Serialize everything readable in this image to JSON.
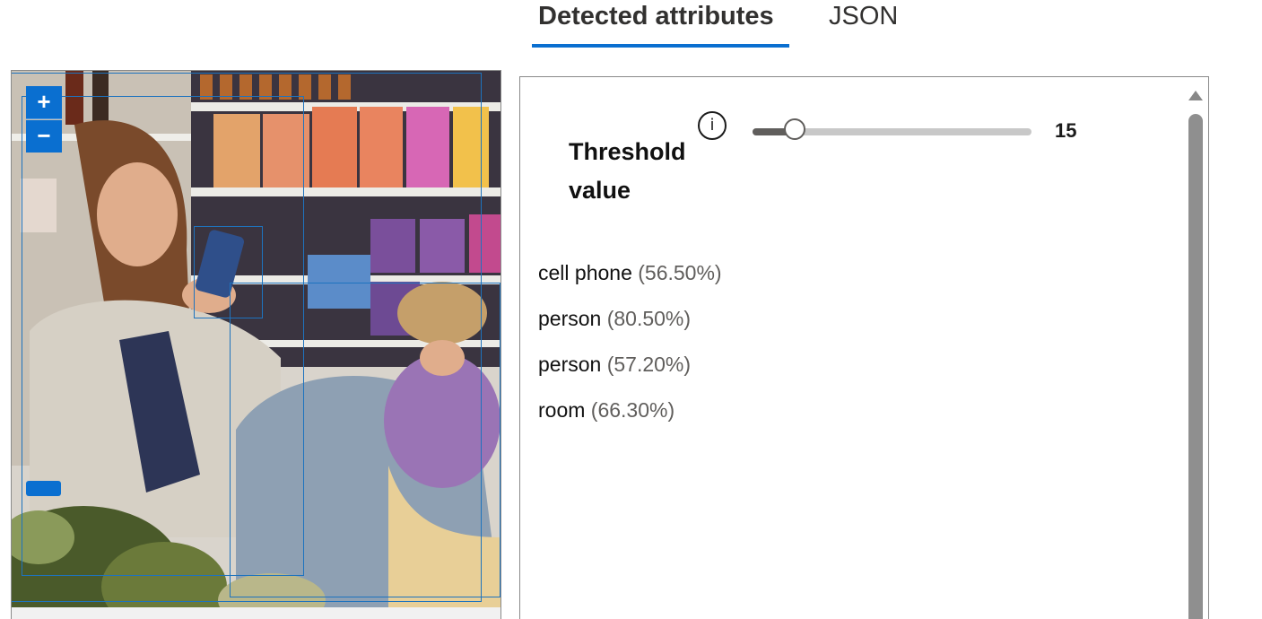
{
  "tabs": [
    {
      "label": "Detected attributes",
      "selected": true
    },
    {
      "label": "JSON",
      "selected": false
    }
  ],
  "viewer": {
    "zoom_in_label": "+",
    "zoom_out_label": "−",
    "image_icon": "store-shopping-photo"
  },
  "threshold": {
    "label": "Threshold value",
    "info_icon_label": "i",
    "value": "15",
    "fraction": 0.15
  },
  "attributes": [
    {
      "name": "cell phone",
      "confidence": "(56.50%)"
    },
    {
      "name": "person",
      "confidence": "(80.50%)"
    },
    {
      "name": "person",
      "confidence": "(57.20%)"
    },
    {
      "name": "room",
      "confidence": "(66.30%)"
    }
  ],
  "colors": {
    "accent": "#0a6fd0",
    "bbox": "#1e73be",
    "slider_fill": "#605e5c",
    "scrollbar": "#8f8f8f"
  }
}
